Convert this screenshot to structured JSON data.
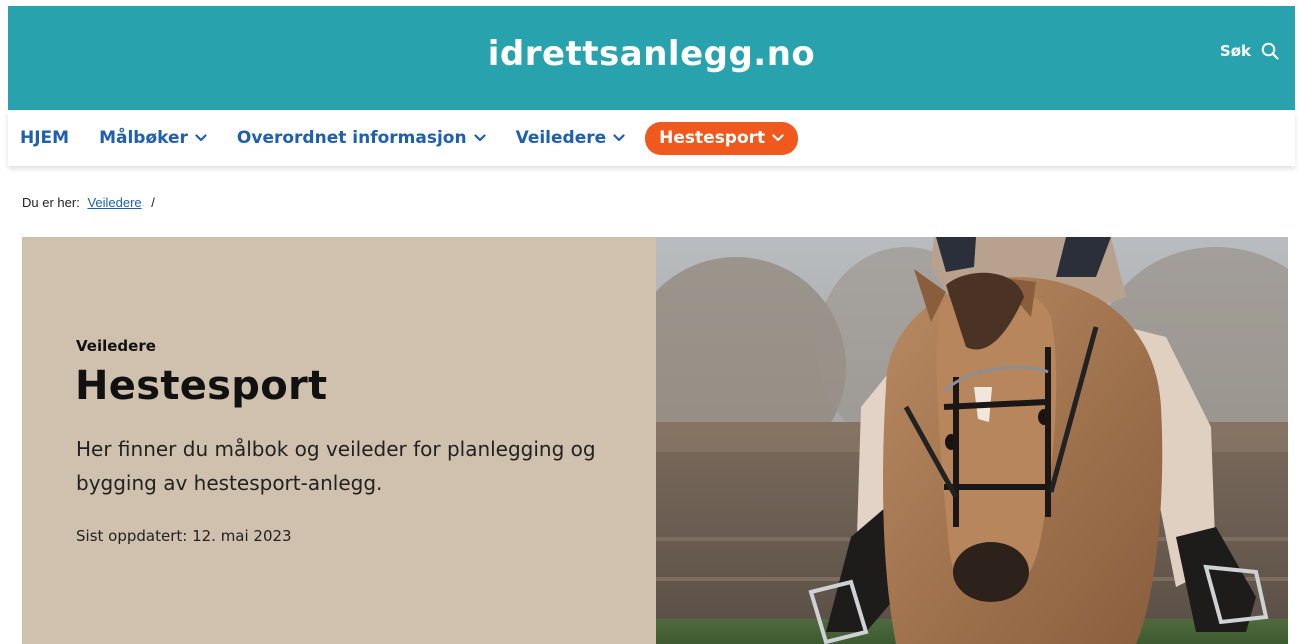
{
  "header": {
    "site_title": "idrettsanlegg.no",
    "search_label": "Søk",
    "search_icon": "search-icon",
    "background": "#28a2ad"
  },
  "nav": {
    "items": [
      {
        "label": "HJEM",
        "has_dropdown": false,
        "active": false
      },
      {
        "label": "Målbøker",
        "has_dropdown": true,
        "active": false
      },
      {
        "label": "Overordnet informasjon",
        "has_dropdown": true,
        "active": false
      },
      {
        "label": "Veiledere",
        "has_dropdown": true,
        "active": false
      },
      {
        "label": "Hestesport",
        "has_dropdown": true,
        "active": true
      }
    ],
    "link_color": "#1f5fb0",
    "active_color": "#f0591d"
  },
  "breadcrumb": {
    "prefix": "Du er her:",
    "link": "Veiledere",
    "separator": "/"
  },
  "hero": {
    "kicker": "Veiledere",
    "title": "Hestesport",
    "lead": "Her finner du målbok og veileder for planlegging og bygging av hestesport-anlegg.",
    "updated": "Sist oppdatert: 12. mai 2023",
    "panel_color": "#d0c1ae",
    "image": "horse-rider-photo"
  }
}
